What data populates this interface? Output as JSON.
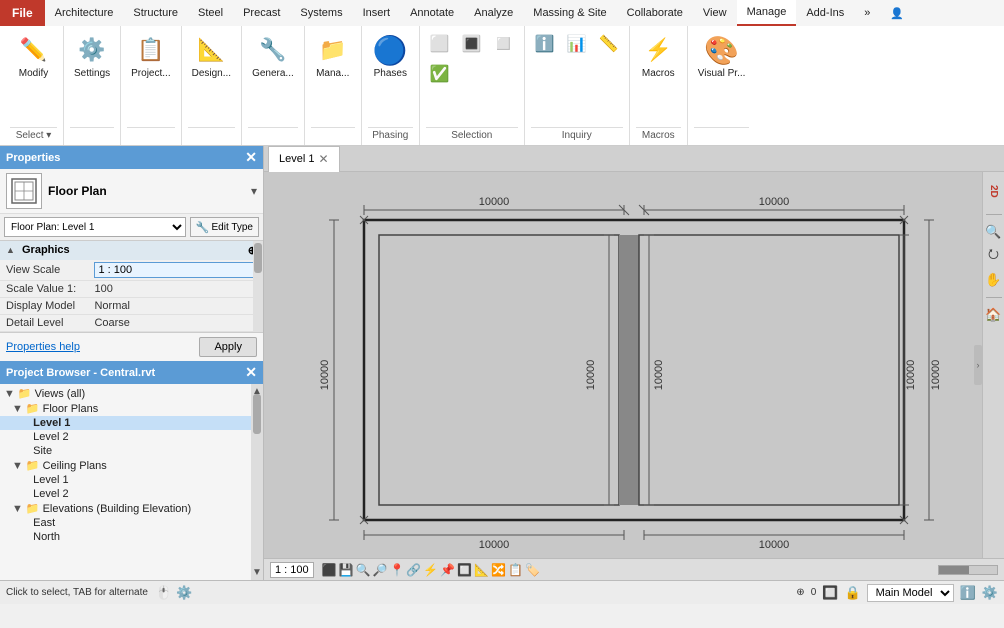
{
  "menubar": {
    "file_label": "File",
    "items": [
      "Architecture",
      "Structure",
      "Steel",
      "Precast",
      "Systems",
      "Insert",
      "Annotate",
      "Analyze",
      "Massing & Site",
      "Collaborate",
      "View",
      "Manage",
      "Add-Ins"
    ]
  },
  "ribbon": {
    "active_tab": "Manage",
    "groups": [
      {
        "name": "modify-group",
        "label": "Select",
        "buttons": [
          {
            "id": "modify-btn",
            "label": "Modify",
            "icon": "✏️"
          }
        ],
        "dropdown": true
      },
      {
        "name": "settings-group",
        "label": "",
        "buttons": [
          {
            "id": "settings-btn",
            "label": "Settings",
            "icon": "⚙️"
          }
        ],
        "dropdown": true
      },
      {
        "name": "project-group",
        "label": "",
        "buttons": [
          {
            "id": "project-btn",
            "label": "Project...",
            "icon": "📋"
          }
        ],
        "dropdown": true
      },
      {
        "name": "design-group",
        "label": "",
        "buttons": [
          {
            "id": "design-btn",
            "label": "Design...",
            "icon": "📐"
          }
        ],
        "dropdown": true
      },
      {
        "name": "genera-group",
        "label": "",
        "buttons": [
          {
            "id": "genera-btn",
            "label": "Genera...",
            "icon": "🔧"
          }
        ],
        "dropdown": true
      },
      {
        "name": "manage-group",
        "label": "",
        "buttons": [
          {
            "id": "manage-btn",
            "label": "Mana...",
            "icon": "📁"
          }
        ],
        "dropdown": true
      },
      {
        "name": "phases-group",
        "label": "Phasing",
        "buttons": [
          {
            "id": "phases-btn",
            "label": "Phases",
            "icon": "🔵"
          }
        ],
        "dropdown": false
      },
      {
        "name": "selection-group",
        "label": "Selection",
        "buttons": [
          {
            "id": "sel-btn1",
            "label": "",
            "icon": "⬜"
          },
          {
            "id": "sel-btn2",
            "label": "",
            "icon": "🔳"
          },
          {
            "id": "sel-btn3",
            "label": "",
            "icon": "◻️"
          },
          {
            "id": "sel-btn4",
            "label": "",
            "icon": "✅"
          }
        ],
        "dropdown": false
      },
      {
        "name": "inquiry-group",
        "label": "Inquiry",
        "buttons": [
          {
            "id": "inq-btn1",
            "label": "",
            "icon": "ℹ️"
          },
          {
            "id": "inq-btn2",
            "label": "",
            "icon": "📊"
          },
          {
            "id": "inq-btn3",
            "label": "",
            "icon": "📏"
          }
        ],
        "dropdown": false
      },
      {
        "name": "macros-group",
        "label": "Macros",
        "buttons": [
          {
            "id": "mac-btn",
            "label": "Macros",
            "icon": "⚡"
          }
        ],
        "dropdown": true
      },
      {
        "name": "visual-group",
        "label": "",
        "buttons": [
          {
            "id": "vis-btn",
            "label": "Visual Pr...",
            "icon": "🎨"
          }
        ],
        "dropdown": false
      }
    ]
  },
  "select_bar": {
    "label": "Select",
    "arrow": "▾"
  },
  "properties": {
    "header": "Properties",
    "type_label": "Floor Plan",
    "type_icon": "🏠",
    "instance_value": "Floor Plan: Level 1",
    "edit_type_label": "Edit Type",
    "sections": [
      {
        "name": "Graphics",
        "arrow": "▲",
        "rows": [
          {
            "key": "View Scale",
            "value": "1 : 100",
            "editable": true
          },
          {
            "key": "Scale Value  1:",
            "value": "100",
            "editable": false
          },
          {
            "key": "Display Model",
            "value": "Normal",
            "editable": false
          },
          {
            "key": "Detail Level",
            "value": "Coarse",
            "editable": false
          }
        ]
      }
    ],
    "help_link": "Properties help",
    "apply_label": "Apply"
  },
  "project_browser": {
    "header": "Project Browser - Central.rvt",
    "tree": [
      {
        "level": 0,
        "label": "Views (all)",
        "icon": "▼",
        "type": "folder"
      },
      {
        "level": 1,
        "label": "Floor Plans",
        "icon": "▼",
        "type": "folder"
      },
      {
        "level": 2,
        "label": "Level 1",
        "icon": "",
        "type": "item",
        "selected": true
      },
      {
        "level": 2,
        "label": "Level 2",
        "icon": "",
        "type": "item"
      },
      {
        "level": 2,
        "label": "Site",
        "icon": "",
        "type": "item"
      },
      {
        "level": 1,
        "label": "Ceiling Plans",
        "icon": "▼",
        "type": "folder"
      },
      {
        "level": 2,
        "label": "Level 1",
        "icon": "",
        "type": "item"
      },
      {
        "level": 2,
        "label": "Level 2",
        "icon": "",
        "type": "item"
      },
      {
        "level": 1,
        "label": "Elevations (Building Elevation)",
        "icon": "▼",
        "type": "folder"
      },
      {
        "level": 2,
        "label": "East",
        "icon": "",
        "type": "item"
      },
      {
        "level": 2,
        "label": "North",
        "icon": "",
        "type": "item"
      }
    ]
  },
  "canvas": {
    "tab_label": "Level 1",
    "view_scale": "1 : 100",
    "model_name": "Main Model",
    "floor_plan": {
      "outer_top_left_dim": "10000",
      "outer_top_right_dim": "10000",
      "outer_bottom_left_dim": "10000",
      "outer_bottom_right_dim": "10000",
      "left_side_dim": "10000",
      "mid_left_dim": "10000",
      "mid_right_dim": "10000",
      "right_side_dim": "10000"
    }
  },
  "status_bar": {
    "message": "Click to select, TAB for alternate",
    "scale": "1 : 100",
    "model_label": "Main Model",
    "coord": "0"
  },
  "canvas_bottom_icons": [
    "⬛",
    "💾",
    "🔍",
    "🔍",
    "🖨️",
    "📷",
    "📍",
    "🔗",
    "⚡",
    "📌",
    "🔲",
    "📐",
    "🔀",
    "📋",
    "🏷️"
  ]
}
